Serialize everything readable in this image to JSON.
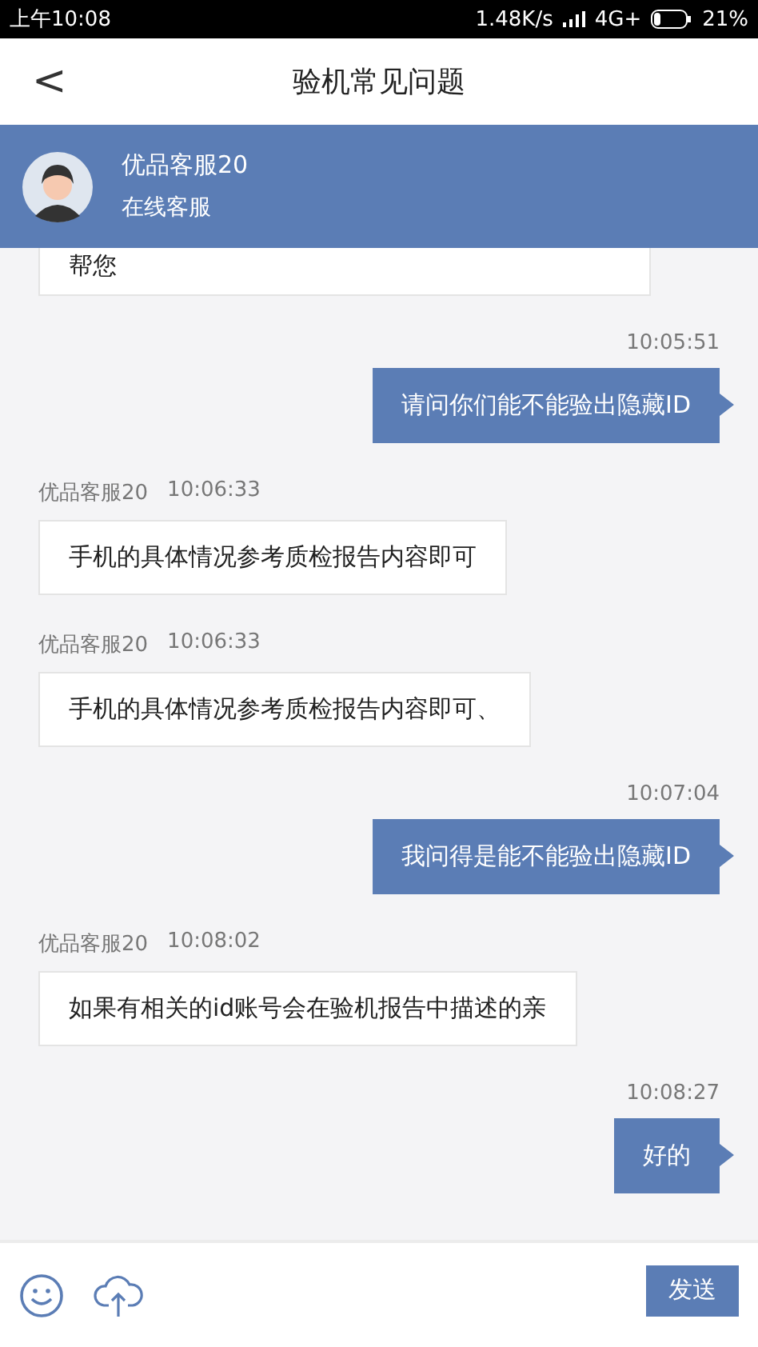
{
  "status_bar": {
    "time": "上午10:08",
    "speed": "1.48K/s",
    "network": "4G+",
    "battery": "21%"
  },
  "nav": {
    "back": "<",
    "title": "验机常见问题"
  },
  "agent": {
    "name": "优品客服20",
    "status": "在线客服"
  },
  "messages": [
    {
      "kind": "incoming",
      "text": "帮您"
    },
    {
      "kind": "outgoing",
      "time": "10:05:51",
      "text": "请问你们能不能验出隐藏ID"
    },
    {
      "kind": "incoming",
      "sender": "优品客服20",
      "time": "10:06:33",
      "text": "手机的具体情况参考质检报告内容即可"
    },
    {
      "kind": "incoming",
      "sender": "优品客服20",
      "time": "10:06:33",
      "text": "手机的具体情况参考质检报告内容即可、"
    },
    {
      "kind": "outgoing",
      "time": "10:07:04",
      "text": "我问得是能不能验出隐藏ID"
    },
    {
      "kind": "incoming",
      "sender": "优品客服20",
      "time": "10:08:02",
      "text": "如果有相关的id账号会在验机报告中描述的亲"
    },
    {
      "kind": "outgoing",
      "time": "10:08:27",
      "text": "好的"
    }
  ],
  "composer": {
    "send": "发送"
  }
}
